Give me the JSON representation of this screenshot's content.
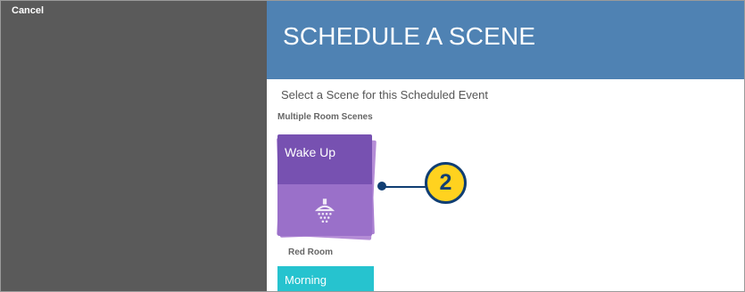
{
  "overlay": {
    "cancel_label": "Cancel"
  },
  "dialog": {
    "title": "SCHEDULE A SCENE",
    "prompt": "Select a Scene for this Scheduled Event",
    "sections": {
      "multiple_room": {
        "label": "Multiple Room Scenes",
        "scene": {
          "name": "Wake Up",
          "icon": "shower-icon"
        }
      },
      "red_room": {
        "label": "Red Room",
        "scene": {
          "name": "Morning"
        }
      }
    }
  },
  "callout": {
    "number": "2"
  },
  "colors": {
    "header": "#4f82b3",
    "scene_purple_top": "#7751b1",
    "scene_purple_bottom": "#9a70c9",
    "scene_teal": "#26c3cf",
    "callout_fill": "#ffd21f",
    "callout_stroke": "#103e73"
  }
}
